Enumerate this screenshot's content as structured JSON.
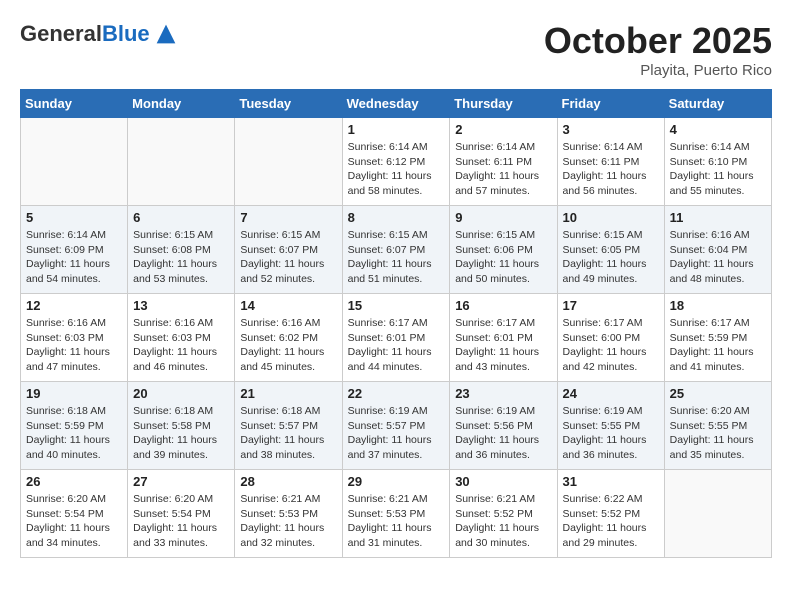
{
  "logo": {
    "general": "General",
    "blue": "Blue"
  },
  "title": "October 2025",
  "location": "Playita, Puerto Rico",
  "weekdays": [
    "Sunday",
    "Monday",
    "Tuesday",
    "Wednesday",
    "Thursday",
    "Friday",
    "Saturday"
  ],
  "weeks": [
    [
      {
        "day": "",
        "info": ""
      },
      {
        "day": "",
        "info": ""
      },
      {
        "day": "",
        "info": ""
      },
      {
        "day": "1",
        "info": "Sunrise: 6:14 AM\nSunset: 6:12 PM\nDaylight: 11 hours and 58 minutes."
      },
      {
        "day": "2",
        "info": "Sunrise: 6:14 AM\nSunset: 6:11 PM\nDaylight: 11 hours and 57 minutes."
      },
      {
        "day": "3",
        "info": "Sunrise: 6:14 AM\nSunset: 6:11 PM\nDaylight: 11 hours and 56 minutes."
      },
      {
        "day": "4",
        "info": "Sunrise: 6:14 AM\nSunset: 6:10 PM\nDaylight: 11 hours and 55 minutes."
      }
    ],
    [
      {
        "day": "5",
        "info": "Sunrise: 6:14 AM\nSunset: 6:09 PM\nDaylight: 11 hours and 54 minutes."
      },
      {
        "day": "6",
        "info": "Sunrise: 6:15 AM\nSunset: 6:08 PM\nDaylight: 11 hours and 53 minutes."
      },
      {
        "day": "7",
        "info": "Sunrise: 6:15 AM\nSunset: 6:07 PM\nDaylight: 11 hours and 52 minutes."
      },
      {
        "day": "8",
        "info": "Sunrise: 6:15 AM\nSunset: 6:07 PM\nDaylight: 11 hours and 51 minutes."
      },
      {
        "day": "9",
        "info": "Sunrise: 6:15 AM\nSunset: 6:06 PM\nDaylight: 11 hours and 50 minutes."
      },
      {
        "day": "10",
        "info": "Sunrise: 6:15 AM\nSunset: 6:05 PM\nDaylight: 11 hours and 49 minutes."
      },
      {
        "day": "11",
        "info": "Sunrise: 6:16 AM\nSunset: 6:04 PM\nDaylight: 11 hours and 48 minutes."
      }
    ],
    [
      {
        "day": "12",
        "info": "Sunrise: 6:16 AM\nSunset: 6:03 PM\nDaylight: 11 hours and 47 minutes."
      },
      {
        "day": "13",
        "info": "Sunrise: 6:16 AM\nSunset: 6:03 PM\nDaylight: 11 hours and 46 minutes."
      },
      {
        "day": "14",
        "info": "Sunrise: 6:16 AM\nSunset: 6:02 PM\nDaylight: 11 hours and 45 minutes."
      },
      {
        "day": "15",
        "info": "Sunrise: 6:17 AM\nSunset: 6:01 PM\nDaylight: 11 hours and 44 minutes."
      },
      {
        "day": "16",
        "info": "Sunrise: 6:17 AM\nSunset: 6:01 PM\nDaylight: 11 hours and 43 minutes."
      },
      {
        "day": "17",
        "info": "Sunrise: 6:17 AM\nSunset: 6:00 PM\nDaylight: 11 hours and 42 minutes."
      },
      {
        "day": "18",
        "info": "Sunrise: 6:17 AM\nSunset: 5:59 PM\nDaylight: 11 hours and 41 minutes."
      }
    ],
    [
      {
        "day": "19",
        "info": "Sunrise: 6:18 AM\nSunset: 5:59 PM\nDaylight: 11 hours and 40 minutes."
      },
      {
        "day": "20",
        "info": "Sunrise: 6:18 AM\nSunset: 5:58 PM\nDaylight: 11 hours and 39 minutes."
      },
      {
        "day": "21",
        "info": "Sunrise: 6:18 AM\nSunset: 5:57 PM\nDaylight: 11 hours and 38 minutes."
      },
      {
        "day": "22",
        "info": "Sunrise: 6:19 AM\nSunset: 5:57 PM\nDaylight: 11 hours and 37 minutes."
      },
      {
        "day": "23",
        "info": "Sunrise: 6:19 AM\nSunset: 5:56 PM\nDaylight: 11 hours and 36 minutes."
      },
      {
        "day": "24",
        "info": "Sunrise: 6:19 AM\nSunset: 5:55 PM\nDaylight: 11 hours and 36 minutes."
      },
      {
        "day": "25",
        "info": "Sunrise: 6:20 AM\nSunset: 5:55 PM\nDaylight: 11 hours and 35 minutes."
      }
    ],
    [
      {
        "day": "26",
        "info": "Sunrise: 6:20 AM\nSunset: 5:54 PM\nDaylight: 11 hours and 34 minutes."
      },
      {
        "day": "27",
        "info": "Sunrise: 6:20 AM\nSunset: 5:54 PM\nDaylight: 11 hours and 33 minutes."
      },
      {
        "day": "28",
        "info": "Sunrise: 6:21 AM\nSunset: 5:53 PM\nDaylight: 11 hours and 32 minutes."
      },
      {
        "day": "29",
        "info": "Sunrise: 6:21 AM\nSunset: 5:53 PM\nDaylight: 11 hours and 31 minutes."
      },
      {
        "day": "30",
        "info": "Sunrise: 6:21 AM\nSunset: 5:52 PM\nDaylight: 11 hours and 30 minutes."
      },
      {
        "day": "31",
        "info": "Sunrise: 6:22 AM\nSunset: 5:52 PM\nDaylight: 11 hours and 29 minutes."
      },
      {
        "day": "",
        "info": ""
      }
    ]
  ]
}
